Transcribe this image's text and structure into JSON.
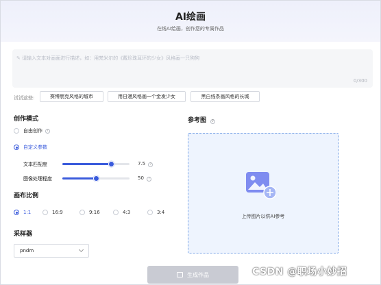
{
  "header": {
    "title": "AI绘画",
    "subtitle": "在线AI绘画，创作您的专属作品"
  },
  "prompt": {
    "placeholder": "请输入文本对画面进行描述，如：用梵米尔的《戴珍珠耳环的少女》风格画一只狗狗",
    "counter": "0/300"
  },
  "suggestions": {
    "label": "试试这些:",
    "chips": [
      "赛博朋克风格的城市",
      "用日漫风格画一个金发少女",
      "黑白线条画风格的长城"
    ]
  },
  "mode": {
    "title": "创作模式",
    "options": [
      {
        "label": "自由创作",
        "selected": false
      },
      {
        "label": "自定义参数",
        "selected": true
      }
    ]
  },
  "sliders": [
    {
      "label": "文本匹配度",
      "value": "7.5",
      "fraction": 0.72
    },
    {
      "label": "图像处理程度",
      "value": "50",
      "fraction": 0.5
    }
  ],
  "ratio": {
    "title": "画布比例",
    "options": [
      {
        "label": "1:1",
        "selected": true
      },
      {
        "label": "16:9",
        "selected": false
      },
      {
        "label": "9:16",
        "selected": false
      },
      {
        "label": "4:3",
        "selected": false
      },
      {
        "label": "3:4",
        "selected": false
      }
    ]
  },
  "sampler": {
    "title": "采样器",
    "value": "pndm"
  },
  "reference": {
    "title": "参考图",
    "upload_text": "上传图片以供AI参考"
  },
  "generate": {
    "label": "生成作品"
  },
  "watermark": "CSDN @职场小妙招",
  "colors": {
    "accent": "#3a5bdc",
    "upload_bg": "#eef4fe",
    "button_disabled": "#c9cbd3"
  }
}
